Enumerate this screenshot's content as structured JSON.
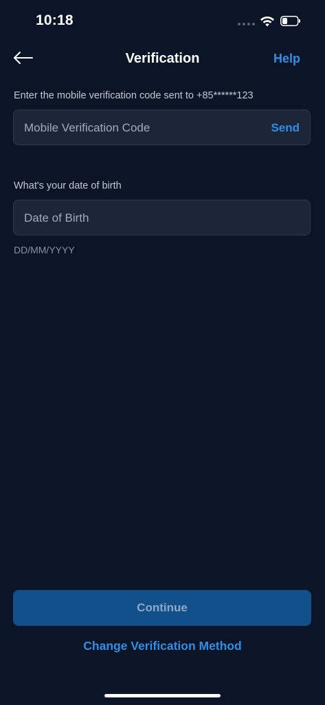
{
  "status_bar": {
    "time": "10:18",
    "icons": [
      "cellular-signal-icon",
      "wifi-icon",
      "battery-icon"
    ]
  },
  "nav": {
    "title": "Verification",
    "back_icon": "back-arrow-icon",
    "help_label": "Help"
  },
  "mobile_code": {
    "label": "Enter the mobile verification code sent to +85******123",
    "placeholder": "Mobile Verification Code",
    "value": "",
    "send_label": "Send"
  },
  "date_of_birth": {
    "label": "What's your date of birth",
    "placeholder": "Date of Birth",
    "value": "",
    "format_hint": "DD/MM/YYYY"
  },
  "actions": {
    "continue_label": "Continue",
    "change_method_label": "Change Verification Method"
  },
  "colors": {
    "background": "#0c1527",
    "field_background": "#1c2638",
    "accent": "#2f8fe6",
    "button_disabled": "#12508c"
  }
}
